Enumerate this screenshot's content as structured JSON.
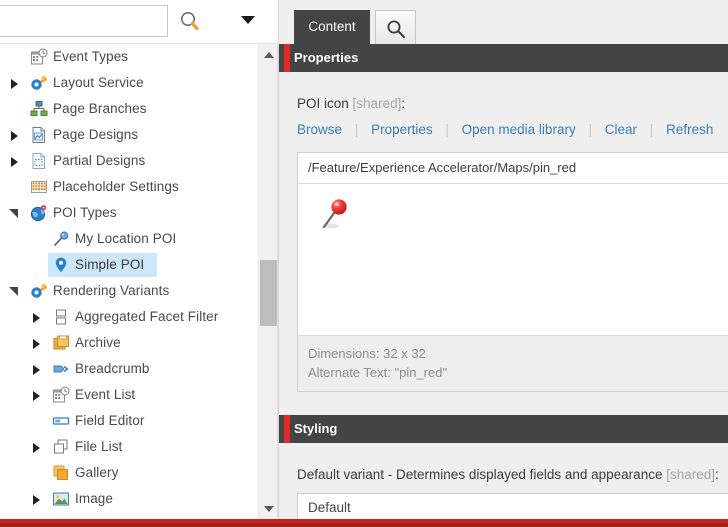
{
  "search": {
    "value": "",
    "placeholder": "",
    "go_icon": "search-icon",
    "caret_icon": "chevron-down-icon"
  },
  "tree": {
    "items": [
      {
        "label": "Event Types",
        "icon": "event-types-icon",
        "depth": 1,
        "twisty": "none",
        "selected": false
      },
      {
        "label": "Layout Service",
        "icon": "layout-service-icon",
        "depth": 1,
        "twisty": "right",
        "selected": false
      },
      {
        "label": "Page Branches",
        "icon": "page-branches-icon",
        "depth": 1,
        "twisty": "none",
        "selected": false
      },
      {
        "label": "Page Designs",
        "icon": "page-designs-icon",
        "depth": 1,
        "twisty": "right",
        "selected": false
      },
      {
        "label": "Partial Designs",
        "icon": "partial-designs-icon",
        "depth": 1,
        "twisty": "right",
        "selected": false
      },
      {
        "label": "Placeholder Settings",
        "icon": "placeholder-settings-icon",
        "depth": 1,
        "twisty": "none",
        "selected": false
      },
      {
        "label": "POI Types",
        "icon": "poi-types-icon",
        "depth": 1,
        "twisty": "down",
        "selected": false
      },
      {
        "label": "My Location POI",
        "icon": "my-location-poi-icon",
        "depth": 2,
        "twisty": "none",
        "selected": false
      },
      {
        "label": "Simple POI",
        "icon": "simple-poi-icon",
        "depth": 2,
        "twisty": "none",
        "selected": true
      },
      {
        "label": "Rendering Variants",
        "icon": "rendering-variants-icon",
        "depth": 1,
        "twisty": "down",
        "selected": false
      },
      {
        "label": "Aggregated Facet Filter",
        "icon": "aggregated-facet-filter-icon",
        "depth": 2,
        "twisty": "right",
        "selected": false
      },
      {
        "label": "Archive",
        "icon": "archive-icon",
        "depth": 2,
        "twisty": "right",
        "selected": false
      },
      {
        "label": "Breadcrumb",
        "icon": "breadcrumb-icon",
        "depth": 2,
        "twisty": "right",
        "selected": false
      },
      {
        "label": "Event List",
        "icon": "event-list-icon",
        "depth": 2,
        "twisty": "right",
        "selected": false
      },
      {
        "label": "Field Editor",
        "icon": "field-editor-icon",
        "depth": 2,
        "twisty": "none",
        "selected": false
      },
      {
        "label": "File List",
        "icon": "file-list-icon",
        "depth": 2,
        "twisty": "right",
        "selected": false
      },
      {
        "label": "Gallery",
        "icon": "gallery-icon",
        "depth": 2,
        "twisty": "none",
        "selected": false
      },
      {
        "label": "Image",
        "icon": "image-icon",
        "depth": 2,
        "twisty": "right",
        "selected": false
      }
    ]
  },
  "tabs": {
    "content_label": "Content",
    "search_icon": "search-icon"
  },
  "sections": {
    "properties": {
      "title": "Properties",
      "poi_icon_label": "POI icon",
      "poi_icon_shared": "[shared]",
      "poi_icon_colon": ":",
      "commands": [
        {
          "label": "Browse"
        },
        {
          "label": "Properties"
        },
        {
          "label": "Open media library"
        },
        {
          "label": "Clear"
        },
        {
          "label": "Refresh"
        }
      ],
      "media_path": "/Feature/Experience Accelerator/Maps/pin_red",
      "preview_icon": "red-pushpin-icon",
      "dimensions": "Dimensions: 32 x 32",
      "alternate_text": "Alternate Text: \"pin_red\""
    },
    "styling": {
      "title": "Styling",
      "variant_label": "Default variant - Determines displayed fields and appearance",
      "variant_shared": "[shared]",
      "variant_colon": ":",
      "variant_value": "Default"
    }
  },
  "colors": {
    "accent_red": "#e02929",
    "header_dark": "#444444",
    "link_blue": "#3b7fb5",
    "selection_blue": "#cbe7f8",
    "bottom_bar": "#a52019"
  }
}
